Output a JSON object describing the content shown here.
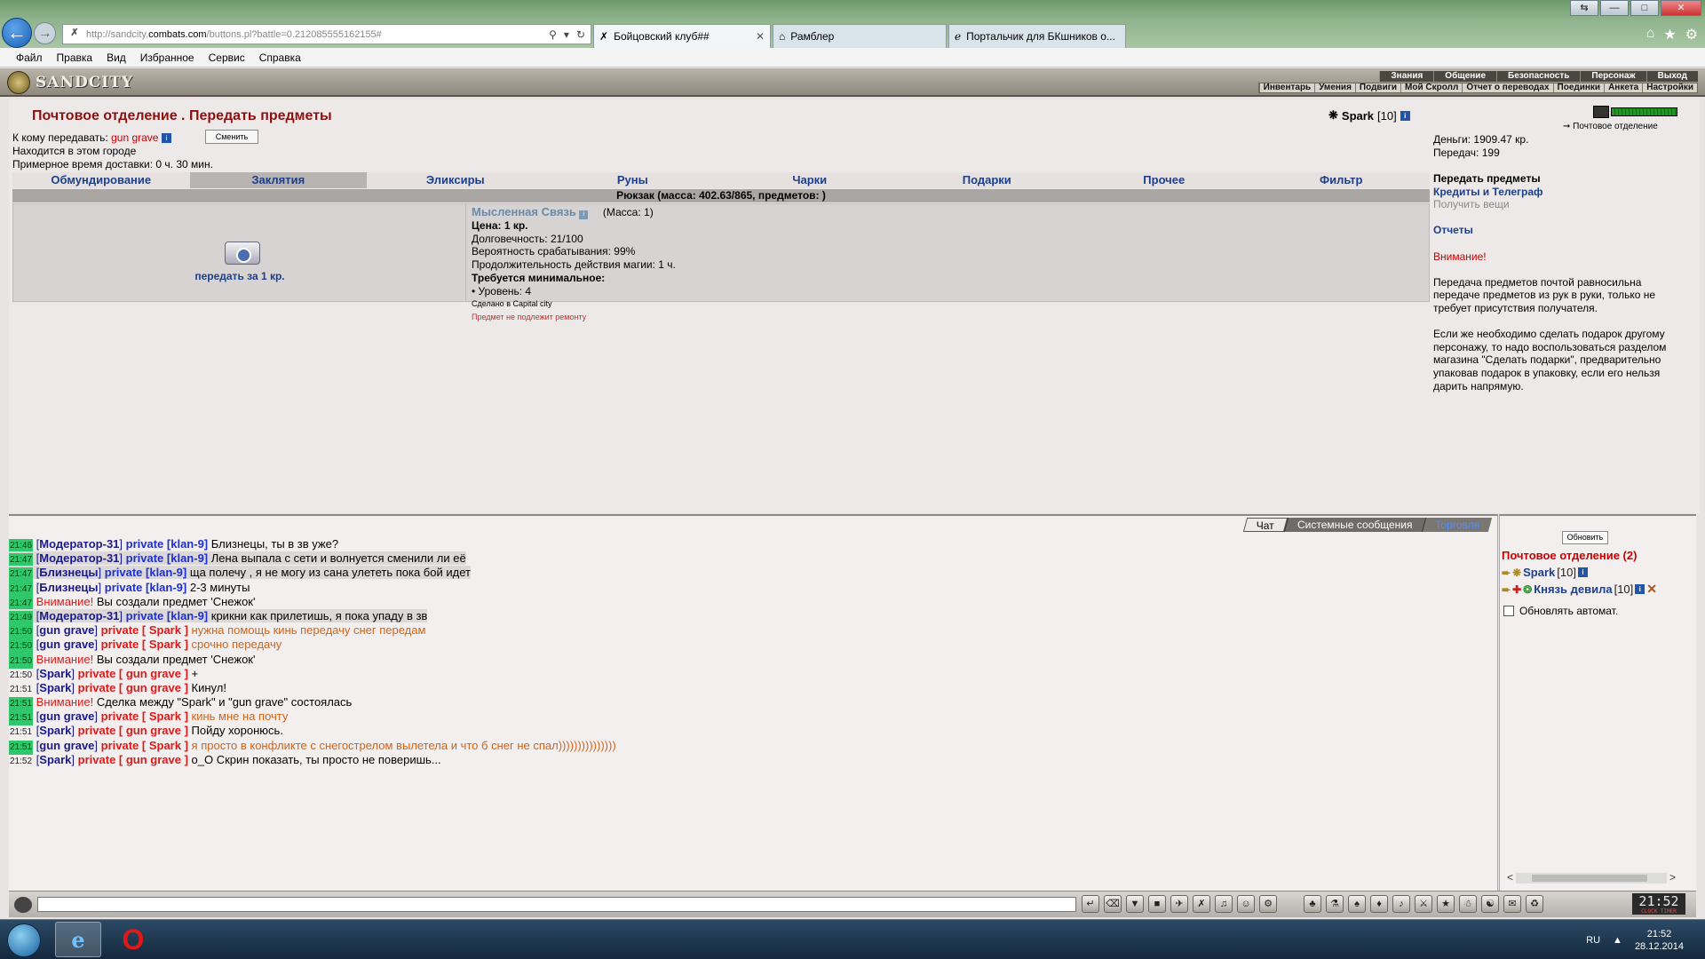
{
  "browser": {
    "url_prefix": "http://sandcity.",
    "url_domain": "combats.com",
    "url_rest": "/buttons.pl?battle=0.212085555162155#",
    "tabs": [
      "Бойцовский клуб##",
      "Рамблер",
      "Портальчик для БКшников о..."
    ],
    "menu": [
      "Файл",
      "Правка",
      "Вид",
      "Избранное",
      "Сервис",
      "Справка"
    ]
  },
  "game": {
    "logo": "SANDCITY",
    "topnav1": [
      "Знания",
      "Общение",
      "Безопасность",
      "Персонаж",
      "Выход"
    ],
    "topnav2": [
      "Инвентарь",
      "Умения",
      "Подвиги",
      "Мой Скролл",
      "Отчет о переводах",
      "Поединки",
      "Анкета",
      "Настройки"
    ]
  },
  "post": {
    "title": "Почтовое отделение .  Передать предметы",
    "to_label": "К кому передавать:",
    "to_name": "gun grave",
    "change_btn": "Сменить",
    "location": "Находится в этом городе",
    "delivery": "Примерное время доставки: 0 ч. 30 мин.",
    "user": "Spark",
    "user_level": "[10]"
  },
  "tabs": [
    "Обмундирование",
    "Заклятия",
    "Эликсиры",
    "Руны",
    "Чарки",
    "Подарки",
    "Прочее",
    "Фильтр"
  ],
  "backpack": "Рюкзак (масса: 402.63/865, предметов: )",
  "item": {
    "pass_link": "передать за 1 кр.",
    "name": "Мысленная Связь",
    "mass": "(Масса: 1)",
    "price": "Цена: 1 кр.",
    "durability": "Долговечность: 21/100",
    "chance": "Вероятность срабатывания: 99%",
    "duration": "Продолжительность действия магии: 1 ч.",
    "req_title": "Требуется минимальное:",
    "req_level": "• Уровень: 4",
    "made_in": "Сделано в Capital city",
    "no_repair": "Предмет не подлежит ремонту"
  },
  "right": {
    "post_link": "Почтовое отделение",
    "money": "Деньги: 1909.47 кр.",
    "transfers": "Передач: 199",
    "link1": "Передать предметы",
    "link2": "Кредиты и Телеграф",
    "link3": "Получить вещи",
    "link4": "Отчеты",
    "warn": "Внимание!",
    "p1": "Передача предметов почтой равносильна передаче предметов из рук в руки, только не требует присутствия получателя.",
    "p2": "Если же необходимо сделать подарок другому персонажу, то надо воспользоваться разделом магазина \"Сделать подарки\", предварительно упаковав подарок в упаковку, если его нельзя дарить напрямую."
  },
  "chat": {
    "tabs": [
      "Чат",
      "Системные сообщения",
      "Торговля"
    ],
    "messages": [
      {
        "time": "21:46",
        "g": true,
        "a": "[",
        "who": "Модератор-31",
        "b": "]",
        "priv": "private [klan-9]",
        "pc": "b",
        "text": "Близнецы, ты в зв уже?",
        "tc": "n",
        "hl": false
      },
      {
        "time": "21:47",
        "g": true,
        "a": "[",
        "who": "Модератор-31",
        "b": "]",
        "priv": "private [klan-9]",
        "pc": "b",
        "text": "Лена выпала с сети и волнуется сменили ли её",
        "tc": "n",
        "hl": true
      },
      {
        "time": "21:47",
        "g": true,
        "a": "[",
        "who": "Близнецы",
        "b": "]",
        "priv": "private [klan-9]",
        "pc": "b",
        "text": "ща полечу , я не могу из сана улететь пока бой идет",
        "tc": "n",
        "hl": true
      },
      {
        "time": "21:47",
        "g": true,
        "a": "[",
        "who": "Близнецы",
        "b": "]",
        "priv": "private [klan-9]",
        "pc": "b",
        "text": "2-3 минуты",
        "tc": "n",
        "hl": false
      },
      {
        "time": "21:47",
        "g": true,
        "warn": "Внимание!",
        "text": "Вы создали предмет 'Снежок'",
        "tc": "n",
        "hl": false
      },
      {
        "time": "21:49",
        "g": true,
        "a": "[",
        "who": "Модератор-31",
        "b": "]",
        "priv": "private [klan-9]",
        "pc": "b",
        "text": "крикни как прилетишь, я пока упаду в зв",
        "tc": "n",
        "hl": true
      },
      {
        "time": "21:50",
        "g": true,
        "a": "[",
        "who": "gun grave",
        "b": "]",
        "priv": "private [ Spark ]",
        "pc": "r",
        "text": "нужна помощь кинь передачу снег передам",
        "tc": "o",
        "hl": false
      },
      {
        "time": "21:50",
        "g": true,
        "a": "[",
        "who": "gun grave",
        "b": "]",
        "priv": "private [ Spark ]",
        "pc": "r",
        "text": "срочно передачу",
        "tc": "o",
        "hl": false
      },
      {
        "time": "21:50",
        "g": true,
        "warn": "Внимание!",
        "text": "Вы создали предмет 'Снежок'",
        "tc": "n",
        "hl": false
      },
      {
        "time": "21:50",
        "g": false,
        "a": "[",
        "who": "Spark",
        "b": "]",
        "priv": "private [ gun grave ]",
        "pc": "r",
        "text": "+",
        "tc": "n",
        "hl": false
      },
      {
        "time": "21:51",
        "g": false,
        "a": "[",
        "who": "Spark",
        "b": "]",
        "priv": "private [ gun grave ]",
        "pc": "r",
        "text": "Кинул!",
        "tc": "n",
        "hl": false
      },
      {
        "time": "21:51",
        "g": true,
        "warn": "Внимание!",
        "text": "Сделка между \"Spark\" и \"gun grave\" состоялась",
        "tc": "n",
        "hl": false
      },
      {
        "time": "21:51",
        "g": true,
        "a": "[",
        "who": "gun grave",
        "b": "]",
        "priv": "private [ Spark ]",
        "pc": "r",
        "text": "кинь мне на почту",
        "tc": "o",
        "hl": false
      },
      {
        "time": "21:51",
        "g": false,
        "a": "[",
        "who": "Spark",
        "b": "]",
        "priv": "private [ gun grave ]",
        "pc": "r",
        "text": "Пойду хоронюсь.",
        "tc": "n",
        "hl": false
      },
      {
        "time": "21:51",
        "g": true,
        "a": "[",
        "who": "gun grave",
        "b": "]",
        "priv": "private [ Spark ]",
        "pc": "r",
        "text": "я просто в конфликте с снегострелом вылетела и что б снег не спал)))))))))))))))",
        "tc": "o",
        "hl": false
      },
      {
        "time": "21:52",
        "g": false,
        "a": "[",
        "who": "Spark",
        "b": "]",
        "priv": "private [ gun grave ]",
        "pc": "r",
        "text": "о_О Скрин показать, ты просто не поверишь...",
        "tc": "n",
        "hl": false
      }
    ]
  },
  "online": {
    "refresh": "Обновить",
    "title": "Почтовое отделение (2)",
    "users": [
      {
        "name": "Spark",
        "level": "[10]"
      },
      {
        "name": "Князь девила",
        "level": "[10]"
      }
    ],
    "auto": "Обновлять автомат."
  },
  "clock": {
    "time": "21:52",
    "sub": "CLOCK TIMER"
  },
  "taskbar": {
    "lang": "RU",
    "time": "21:52",
    "date": "28.12.2014"
  }
}
